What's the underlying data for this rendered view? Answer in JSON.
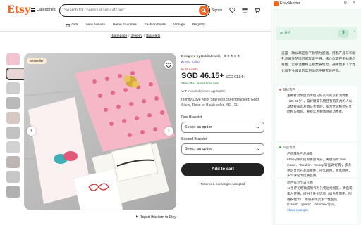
{
  "etsy": {
    "logo": "Etsy",
    "categories": "Categories",
    "search_placeholder": "Search for \"celestial suncatcher\"",
    "sign_in": "Sign in",
    "nav": [
      "Gifts",
      "New Arrivals",
      "Home Favorites",
      "Fashion Finds",
      "Vintage",
      "Registry"
    ],
    "breadcrumb": [
      "Homepage",
      "Jewelry",
      "Bracelets"
    ],
    "badge": "Bestseller",
    "designed_by": "Designed by",
    "shop": "BoldSJewels",
    "stars": "★★★★★",
    "star_seller": "Star Seller",
    "in_basket": "In 20+ carts",
    "price": "SGD 46.15+",
    "old_price": "SGD 61.54+",
    "discount": "25% off • Limited time sale",
    "vat": "VAT included (where applicable)",
    "title": "Infinity Love Knot Stainless Steel Bracelet: Gold, Silver, Rose or Black color, XS - XL",
    "first_label": "First Bracelet",
    "first_value": "Select an option",
    "second_label": "Second Bracelet",
    "second_value": "Select an option",
    "add_to_cart": "Add to cart",
    "returns": "Returns & exchanges",
    "returns_status": "Accepted",
    "report": "Report this item to Etsy"
  },
  "panel": {
    "title": "Etsy Hunter",
    "ai_label": "AI 分析",
    "score": "9",
    "summary": "这是一款以高品质不锈钢为基础、搭配产品与和谐礼品属性的情侣或友谊手链，核心优势在于材质可靠性、卖家温馨赠言视觉表现力、通用性手工个性化和专业设计的实用情侣手链套装产品。",
    "sections": [
      {
        "heading": "目标客户",
        "color": "#e57373",
        "text": "主要针对情侣及情侣与好友间的交友消费者（25-45岁），偏好精美礼物且有购买力的人以及想要表达友情与亲情的，多为合同格式分享结构与情感、重视实用和情感的消费者。"
      },
      {
        "heading": "产品优点",
        "color": "#4caf50",
        "sub": "产品属性产品质量",
        "text": "91%的评论提到质量评分，关键词如 'well made'、'durable'、'sturdy'等强调'好看'，多条评论显示产品品质佳、持久耐用、防水耐用，多个评论为优质品质。",
        "link": "Show example"
      },
      {
        "heading": "",
        "color": "#4caf50",
        "sub": "适合作为节日礼物",
        "text": "12条评论明确提到作为礼物送给朋友、情侣或家人使用，提供个性化选项（如免费刻字、附赠祝福卡），情感表现卖家个性包装，如'sent'、'gentle'、'attentive'等词。",
        "link": "Show example"
      }
    ]
  }
}
